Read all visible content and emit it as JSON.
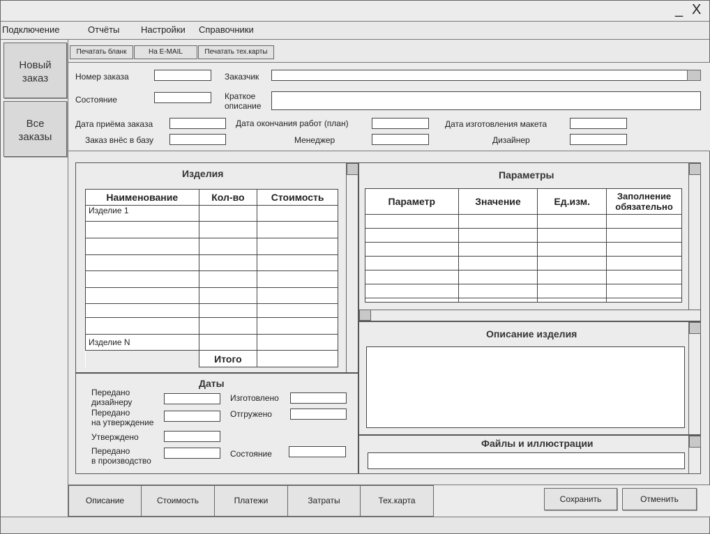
{
  "window": {
    "minimize_label": "_",
    "close_label": "X"
  },
  "menu": [
    "Подключение",
    "Отчёты",
    "Настройки",
    "Справочники"
  ],
  "sidebar": {
    "new_order": "Новый заказ",
    "all_orders": "Все заказы"
  },
  "toolbar": {
    "print_form": "Печатать бланк",
    "email": "На E-MAIL",
    "print_tech": "Печатать тех.карты"
  },
  "form": {
    "order_number": "Номер заказа",
    "customer": "Заказчик",
    "state": "Состояние",
    "short_description_1": "Краткое",
    "short_description_2": "описание",
    "date_received": "Дата приёма заказа",
    "date_end_plan": "Дата окончания работ (план)",
    "date_mockup": "Дата изготовления макета",
    "entered_by": "Заказ внёс в базу",
    "manager": "Менеджер",
    "designer": "Дизайнер"
  },
  "products": {
    "title": "Изделия",
    "columns": [
      "Наименование",
      "Кол-во",
      "Стоимость"
    ],
    "rows": [
      "Изделие 1",
      "",
      "",
      "",
      "",
      "",
      "",
      "",
      "Изделие N"
    ],
    "total_label": "Итого"
  },
  "params": {
    "title": "Параметры",
    "columns": [
      "Параметр",
      "Значение",
      "Ед.изм.",
      "Заполнение обязательно"
    ]
  },
  "dates": {
    "title": "Даты",
    "to_designer_1": "Передано",
    "to_designer_2": "дизайнеру",
    "to_approval_1": "Передано",
    "to_approval_2": "на утверждение",
    "approved": "Утверждено",
    "to_production_1": "Передано",
    "to_production_2": "в производство",
    "manufactured": "Изготовлено",
    "shipped": "Отгружено",
    "state": "Состояние"
  },
  "description": {
    "title": "Описание изделия"
  },
  "files": {
    "title": "Файлы и иллюстрации"
  },
  "bottom_tabs": [
    "Описание",
    "Стоимость",
    "Платежи",
    "Затраты",
    "Тех.карта"
  ],
  "actions": {
    "save": "Сохранить",
    "cancel": "Отменить"
  }
}
